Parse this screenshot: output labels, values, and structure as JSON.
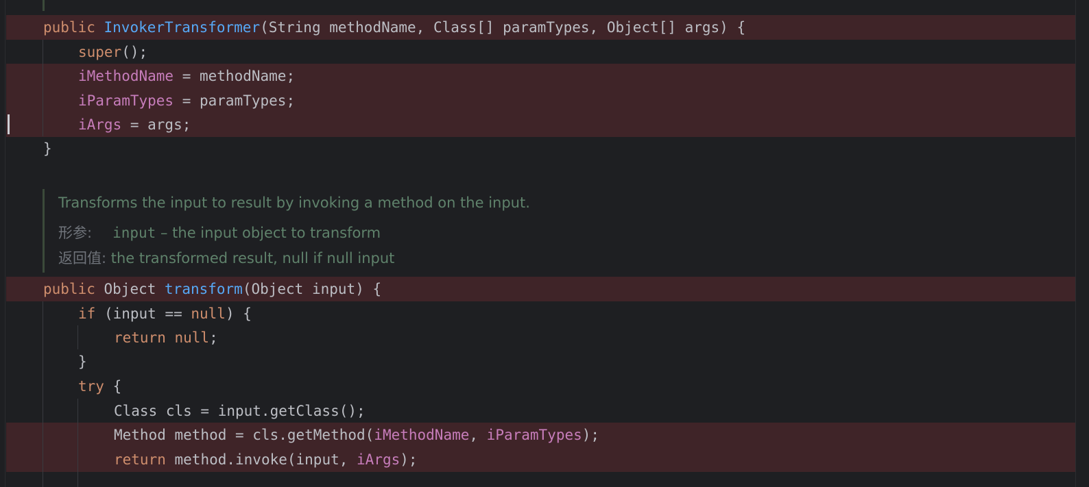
{
  "code_lines": [
    {
      "parts": [
        {
          "t": "public ",
          "c": "kw"
        },
        {
          "t": "InvokerTransformer",
          "c": "fn"
        },
        {
          "t": "(String methodName, Class[] paramTypes, Object[] args) {",
          "c": "pl"
        }
      ]
    },
    {
      "parts": [
        {
          "t": "super",
          "c": "kw"
        },
        {
          "t": "();",
          "c": "pl"
        }
      ]
    },
    {
      "parts": [
        {
          "t": "iMethodName",
          "c": "fld"
        },
        {
          "t": " = methodName;",
          "c": "pl"
        }
      ]
    },
    {
      "parts": [
        {
          "t": "iParamTypes",
          "c": "fld"
        },
        {
          "t": " = paramTypes;",
          "c": "pl"
        }
      ]
    },
    {
      "parts": [
        {
          "t": "iArgs",
          "c": "fld"
        },
        {
          "t": " = args;",
          "c": "pl"
        }
      ]
    },
    {
      "parts": [
        {
          "t": "}",
          "c": "pl"
        }
      ]
    },
    {
      "parts": [
        {
          "t": "public ",
          "c": "kw"
        },
        {
          "t": "Object ",
          "c": "pl"
        },
        {
          "t": "transform",
          "c": "fn"
        },
        {
          "t": "(Object input) {",
          "c": "pl"
        }
      ]
    },
    {
      "parts": [
        {
          "t": "if ",
          "c": "kw"
        },
        {
          "t": "(input == ",
          "c": "pl"
        },
        {
          "t": "null",
          "c": "kw"
        },
        {
          "t": ") {",
          "c": "pl"
        }
      ]
    },
    {
      "parts": [
        {
          "t": "return null",
          "c": "kw"
        },
        {
          "t": ";",
          "c": "pl"
        }
      ]
    },
    {
      "parts": [
        {
          "t": "}",
          "c": "pl"
        }
      ]
    },
    {
      "parts": [
        {
          "t": "try ",
          "c": "kw"
        },
        {
          "t": "{",
          "c": "pl"
        }
      ]
    },
    {
      "parts": [
        {
          "t": "Class cls = input.getClass();",
          "c": "pl"
        }
      ]
    },
    {
      "parts": [
        {
          "t": "Method method = cls.getMethod(",
          "c": "pl"
        },
        {
          "t": "iMethodName",
          "c": "fld"
        },
        {
          "t": ", ",
          "c": "pl"
        },
        {
          "t": "iParamTypes",
          "c": "fld"
        },
        {
          "t": ");",
          "c": "pl"
        }
      ]
    },
    {
      "parts": [
        {
          "t": "return ",
          "c": "kw"
        },
        {
          "t": "method.invoke(input, ",
          "c": "pl"
        },
        {
          "t": "iArgs",
          "c": "fld"
        },
        {
          "t": ");",
          "c": "pl"
        }
      ]
    }
  ],
  "doc_comment": {
    "summary": "Transforms the input to result by invoking a method on the input.",
    "param_tag": "形参:",
    "param_name": "input",
    "param_desc": " – the input object to transform",
    "return_tag": "返回值:",
    "return_desc": " the transformed result, null if null input"
  },
  "colors": {
    "background": "#1e1f22",
    "highlight_row": "#3f2428",
    "keyword": "#cf8e6d",
    "method_decl": "#56a8f5",
    "field": "#c77dbb",
    "plain": "#bcbec4",
    "doc_text": "#5f826b"
  }
}
